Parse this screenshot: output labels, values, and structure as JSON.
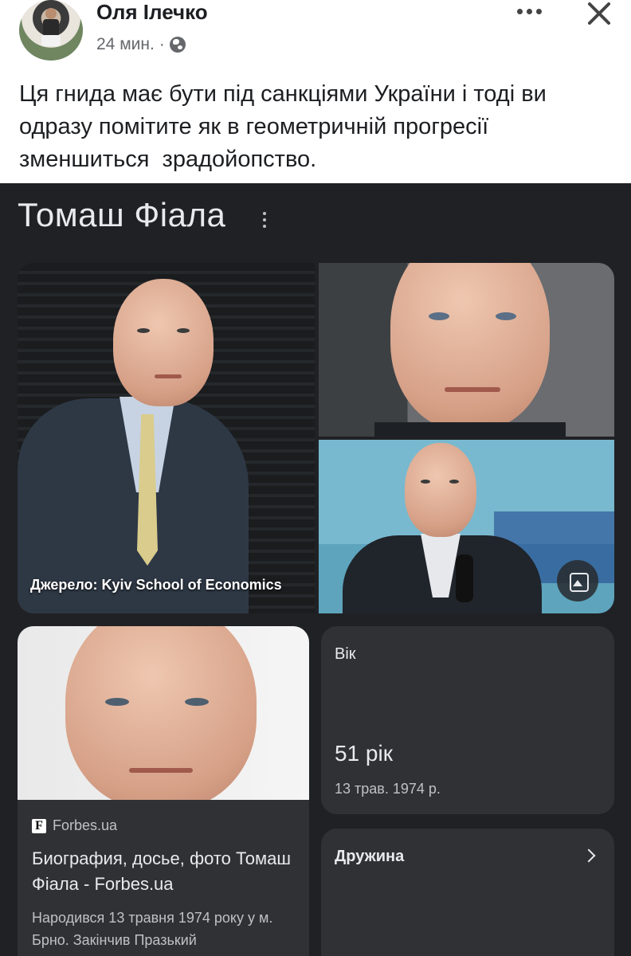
{
  "post": {
    "author": "Оля Ілечко",
    "time": "24 мин.",
    "separator": "·",
    "text": "Ця гнида має бути під санкціями України і тоді ви одразу помітите як в геометричній прогресії зменшиться  зрадойопство."
  },
  "panel": {
    "title": "Томаш Фіала",
    "photo_caption": "Джерело: Kyiv School of Economics",
    "source": {
      "icon_letter": "F",
      "name": "Forbes.ua",
      "title": "Биография, досье, фото Томаш Фіала - Forbes.ua",
      "description": "Народився 13 травня 1974 року у м. Брно. Закінчив Празький"
    },
    "age": {
      "label": "Вік",
      "value": "51 рік",
      "dob": "13 трав. 1974 р."
    },
    "spouse": {
      "label": "Дружина"
    }
  },
  "icons": [
    "globe-icon",
    "more-icon",
    "close-icon",
    "vertical-more-icon",
    "image-icon",
    "forbes-icon",
    "chevron-right-icon"
  ],
  "colors": {
    "panel_bg": "#202124",
    "card_bg": "#303134",
    "text_primary": "#e8eaed",
    "text_secondary": "#bdc1c6"
  }
}
